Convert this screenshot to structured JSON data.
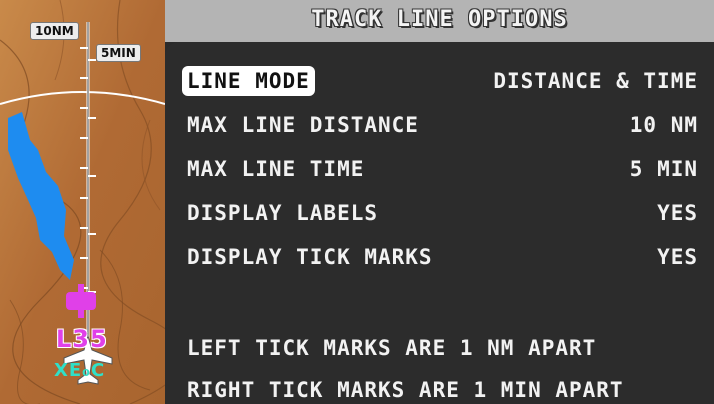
{
  "map": {
    "range_label": "10NM",
    "time_label": "5MIN",
    "waypoint_label": "L35",
    "airport_label": "XE₀C",
    "colors": {
      "terrain": "#b9733a",
      "water": "#1e8cf0",
      "route": "#e040e8",
      "airport_text": "#2fe0c8"
    },
    "icons": [
      "ownship-aircraft-icon",
      "waypoint-marker-icon"
    ]
  },
  "panel": {
    "title": "TRACK LINE OPTIONS",
    "options": [
      {
        "label": "LINE MODE",
        "value": "DISTANCE & TIME",
        "selected": true
      },
      {
        "label": "MAX LINE DISTANCE",
        "value": "10 NM"
      },
      {
        "label": "MAX LINE TIME",
        "value": "5 MIN"
      },
      {
        "label": "DISPLAY LABELS",
        "value": "YES"
      },
      {
        "label": "DISPLAY TICK MARKS",
        "value": "YES"
      }
    ],
    "notes": [
      "LEFT TICK MARKS ARE 1 NM APART",
      "RIGHT TICK MARKS ARE 1 MIN APART"
    ]
  }
}
